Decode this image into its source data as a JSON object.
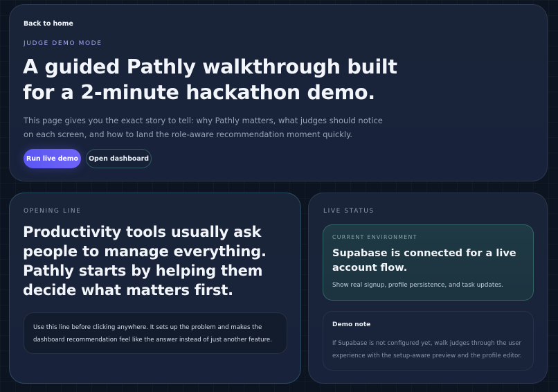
{
  "hero": {
    "back_link": "Back to home",
    "eyebrow": "JUDGE DEMO MODE",
    "title": "A guided Pathly walkthrough built for a 2-minute hackathon demo.",
    "description": "This page gives you the exact story to tell: why Pathly matters, what judges should notice on each screen, and how to land the role-aware recommendation moment quickly.",
    "primary_button": "Run live demo",
    "secondary_button": "Open dashboard"
  },
  "opening": {
    "eyebrow": "OPENING LINE",
    "line": "Productivity tools usually ask people to manage everything. Pathly starts by helping them decide what matters first.",
    "tip": "Use this line before clicking anywhere. It sets up the problem and makes the dashboard recommendation feel like the answer instead of just another feature."
  },
  "status": {
    "eyebrow": "LIVE STATUS",
    "environment": {
      "eyebrow": "CURRENT ENVIRONMENT",
      "title": "Supabase is connected for a live account flow.",
      "description": "Show real signup, profile persistence, and task updates."
    },
    "note": {
      "title": "Demo note",
      "description": "If Supabase is not configured yet, walk judges through the user experience with the setup-aware preview and the profile editor."
    }
  },
  "colors": {
    "background": "#0b1420",
    "card": "#1a2438",
    "accent": "#5b57f3",
    "eyebrow_accent": "#a5a6f6",
    "env_box": "#1f3a44"
  }
}
